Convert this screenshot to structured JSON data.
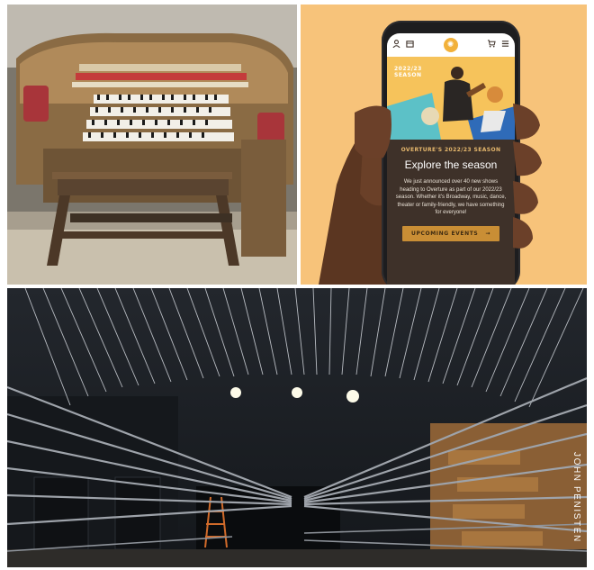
{
  "collage": {
    "photos": [
      {
        "name": "theatre-organ-console"
      },
      {
        "name": "phone-app-screenshot"
      },
      {
        "name": "stage-fly-system"
      }
    ]
  },
  "phone_app": {
    "nav_icons": [
      "user-icon",
      "calendar-icon",
      "logo-icon",
      "cart-icon",
      "menu-icon"
    ],
    "hero_season_label": "2022/23 SEASON",
    "eyebrow": "OVERTURE'S 2022/23 SEASON",
    "headline": "Explore the season",
    "body": "We just announced over 40 new shows heading to Overture as part of our 2022/23 season. Whether it's Broadway, music, dance, theater or family-friendly, we have something for everyone!",
    "cta_label": "UPCOMING EVENTS",
    "cta_arrow": "→",
    "colors": {
      "background": "#f7c37a",
      "screen": "#3e3129",
      "accent": "#c98e35",
      "hero": "#f6c35b"
    }
  },
  "photo_credit": "JOHN PENISTEN"
}
